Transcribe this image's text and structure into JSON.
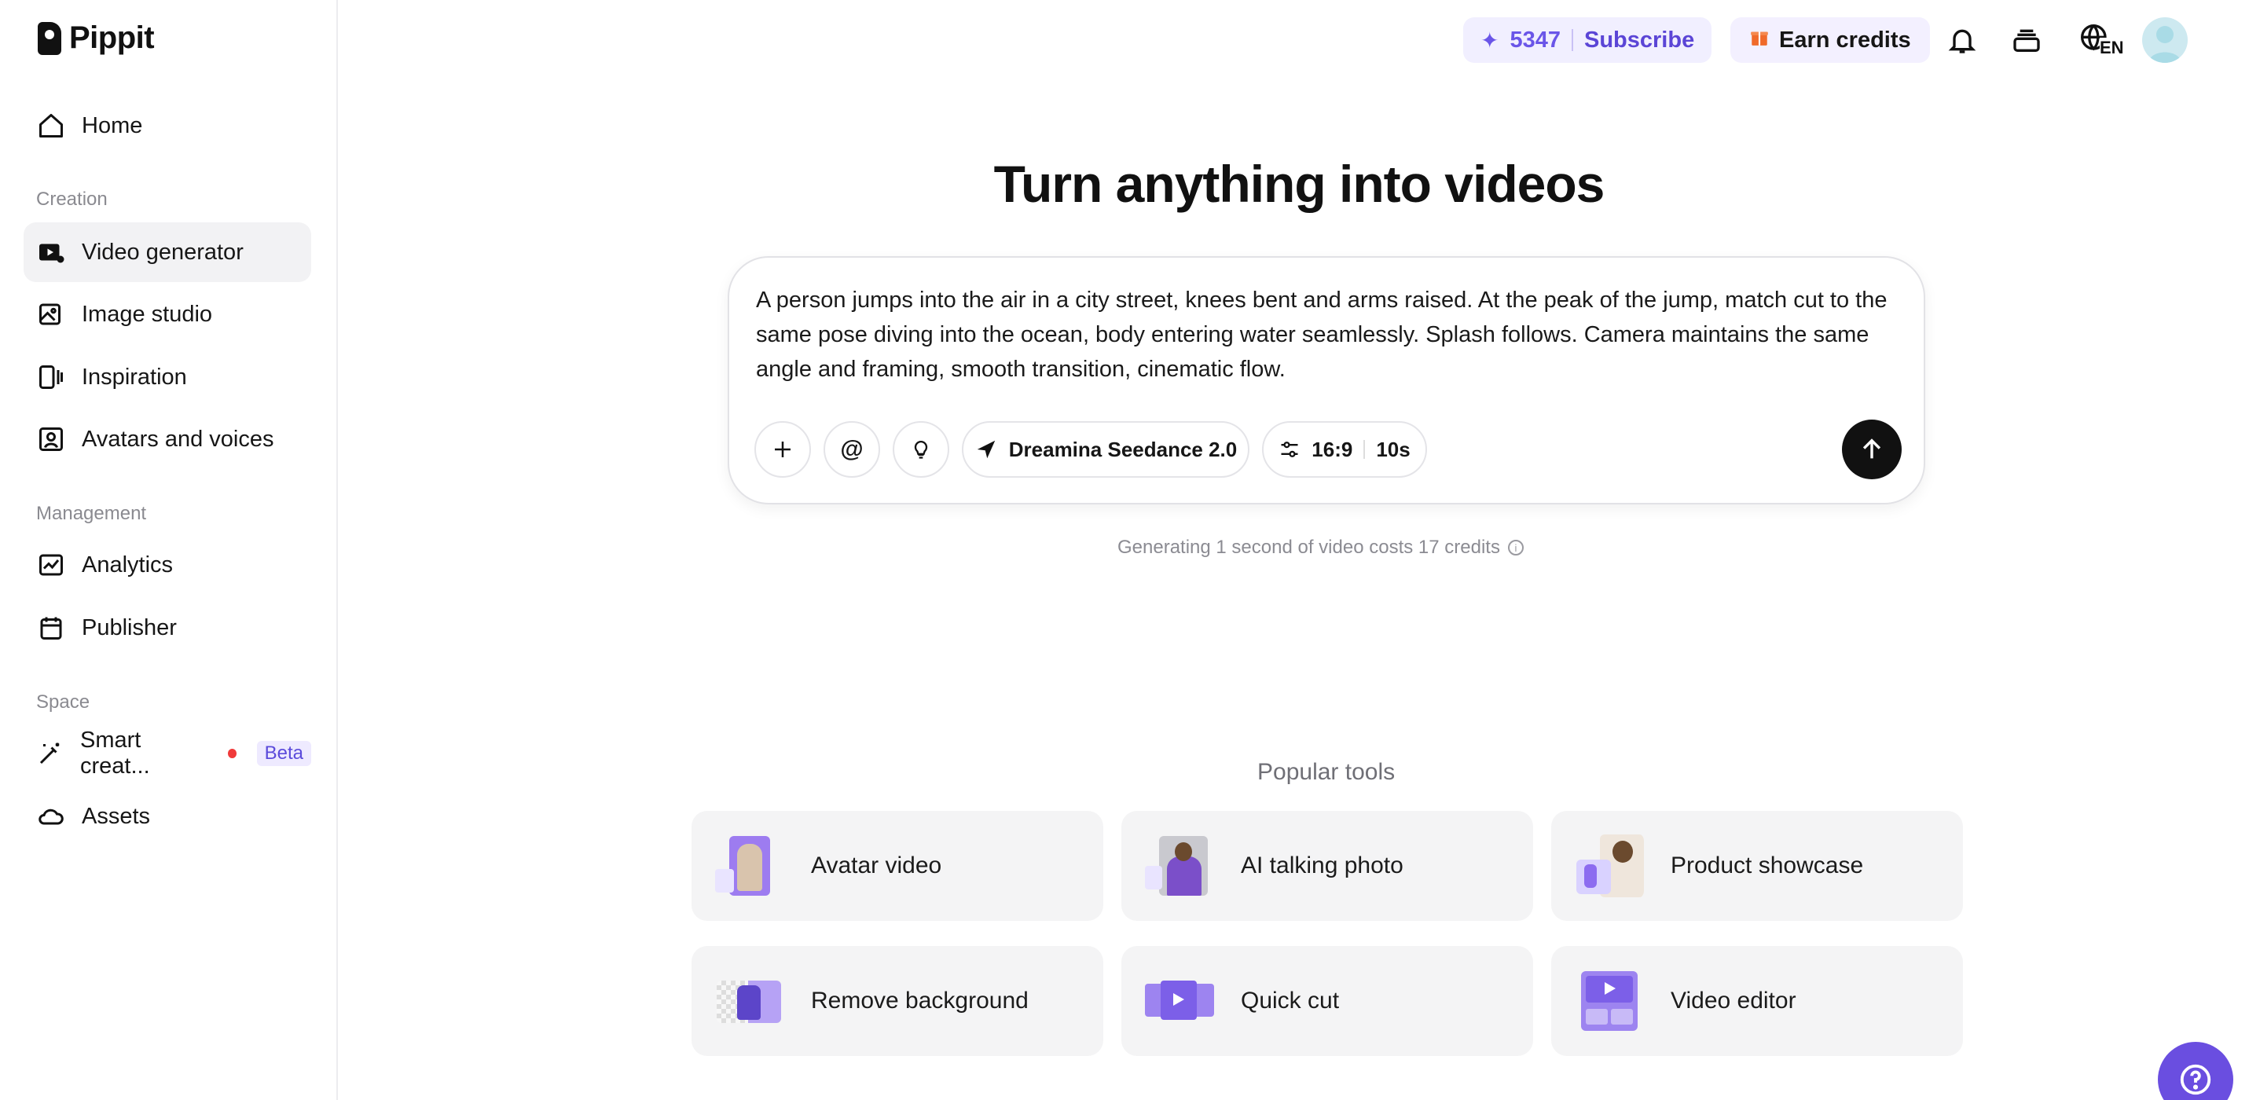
{
  "app": {
    "name": "Pippit"
  },
  "sidebar": {
    "items": [
      {
        "label": "Home",
        "icon": "home-icon"
      },
      {
        "label": "Video generator",
        "icon": "video-generator-icon",
        "active": true
      },
      {
        "label": "Image studio",
        "icon": "image-studio-icon"
      },
      {
        "label": "Inspiration",
        "icon": "inspiration-icon"
      },
      {
        "label": "Avatars and voices",
        "icon": "avatar-icon"
      },
      {
        "label": "Analytics",
        "icon": "analytics-icon"
      },
      {
        "label": "Publisher",
        "icon": "calendar-icon"
      },
      {
        "label": "Smart creat...",
        "icon": "magic-wand-icon",
        "badge": "Beta"
      },
      {
        "label": "Assets",
        "icon": "cloud-icon"
      }
    ],
    "sections": {
      "creation": "Creation",
      "management": "Management",
      "space": "Space"
    }
  },
  "topbar": {
    "credits": "5347",
    "subscribe_label": "Subscribe",
    "earn_label": "Earn credits",
    "language": "EN"
  },
  "main": {
    "title": "Turn anything into videos",
    "prompt_text": "A person jumps into the air in a city street, knees bent and arms raised. At the peak of the jump, match cut to the same pose diving into the ocean, body entering water seamlessly. Splash follows. Camera maintains the same angle and framing, smooth transition, cinematic flow.",
    "model_label": "Dreamina Seedance 2.0",
    "ratio": "16:9",
    "duration": "10s",
    "cost_note": "Generating 1 second of video costs 17 credits",
    "popular_title": "Popular tools",
    "tools": [
      {
        "label": "Avatar video"
      },
      {
        "label": "AI talking photo"
      },
      {
        "label": "Product showcase"
      },
      {
        "label": "Remove background"
      },
      {
        "label": "Quick cut"
      },
      {
        "label": "Video editor"
      }
    ]
  },
  "colors": {
    "accent": "#6a4ee0",
    "credits": "#6a55e8",
    "active_bg": "#f2f2f4"
  }
}
